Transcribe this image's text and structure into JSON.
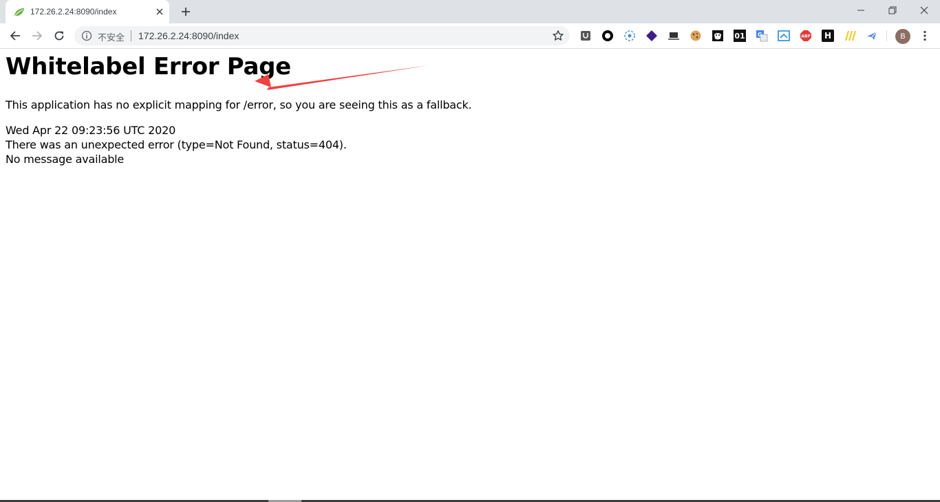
{
  "tab": {
    "title": "172.26.2.24:8090/index",
    "favicon": "spring-leaf-icon"
  },
  "toolbar": {
    "security_label": "不安全",
    "url": "172.26.2.24:8090/index",
    "avatar_letter": "B"
  },
  "extensions": {
    "ext_01_label": "01",
    "ext_h_label": "H",
    "ext_abp_label": "ABP"
  },
  "page": {
    "heading": "Whitelabel Error Page",
    "description": "This application has no explicit mapping for /error, so you are seeing this as a fallback.",
    "timestamp": "Wed Apr 22 09:23:56 UTC 2020",
    "error_line": "There was an unexpected error (type=Not Found, status=404).",
    "message_line": "No message available"
  },
  "colors": {
    "tabstrip_bg": "#dee1e6",
    "omnibox_bg": "#f1f3f4",
    "annotation_arrow": "#f04040",
    "avatar_bg": "#8d6e63"
  }
}
